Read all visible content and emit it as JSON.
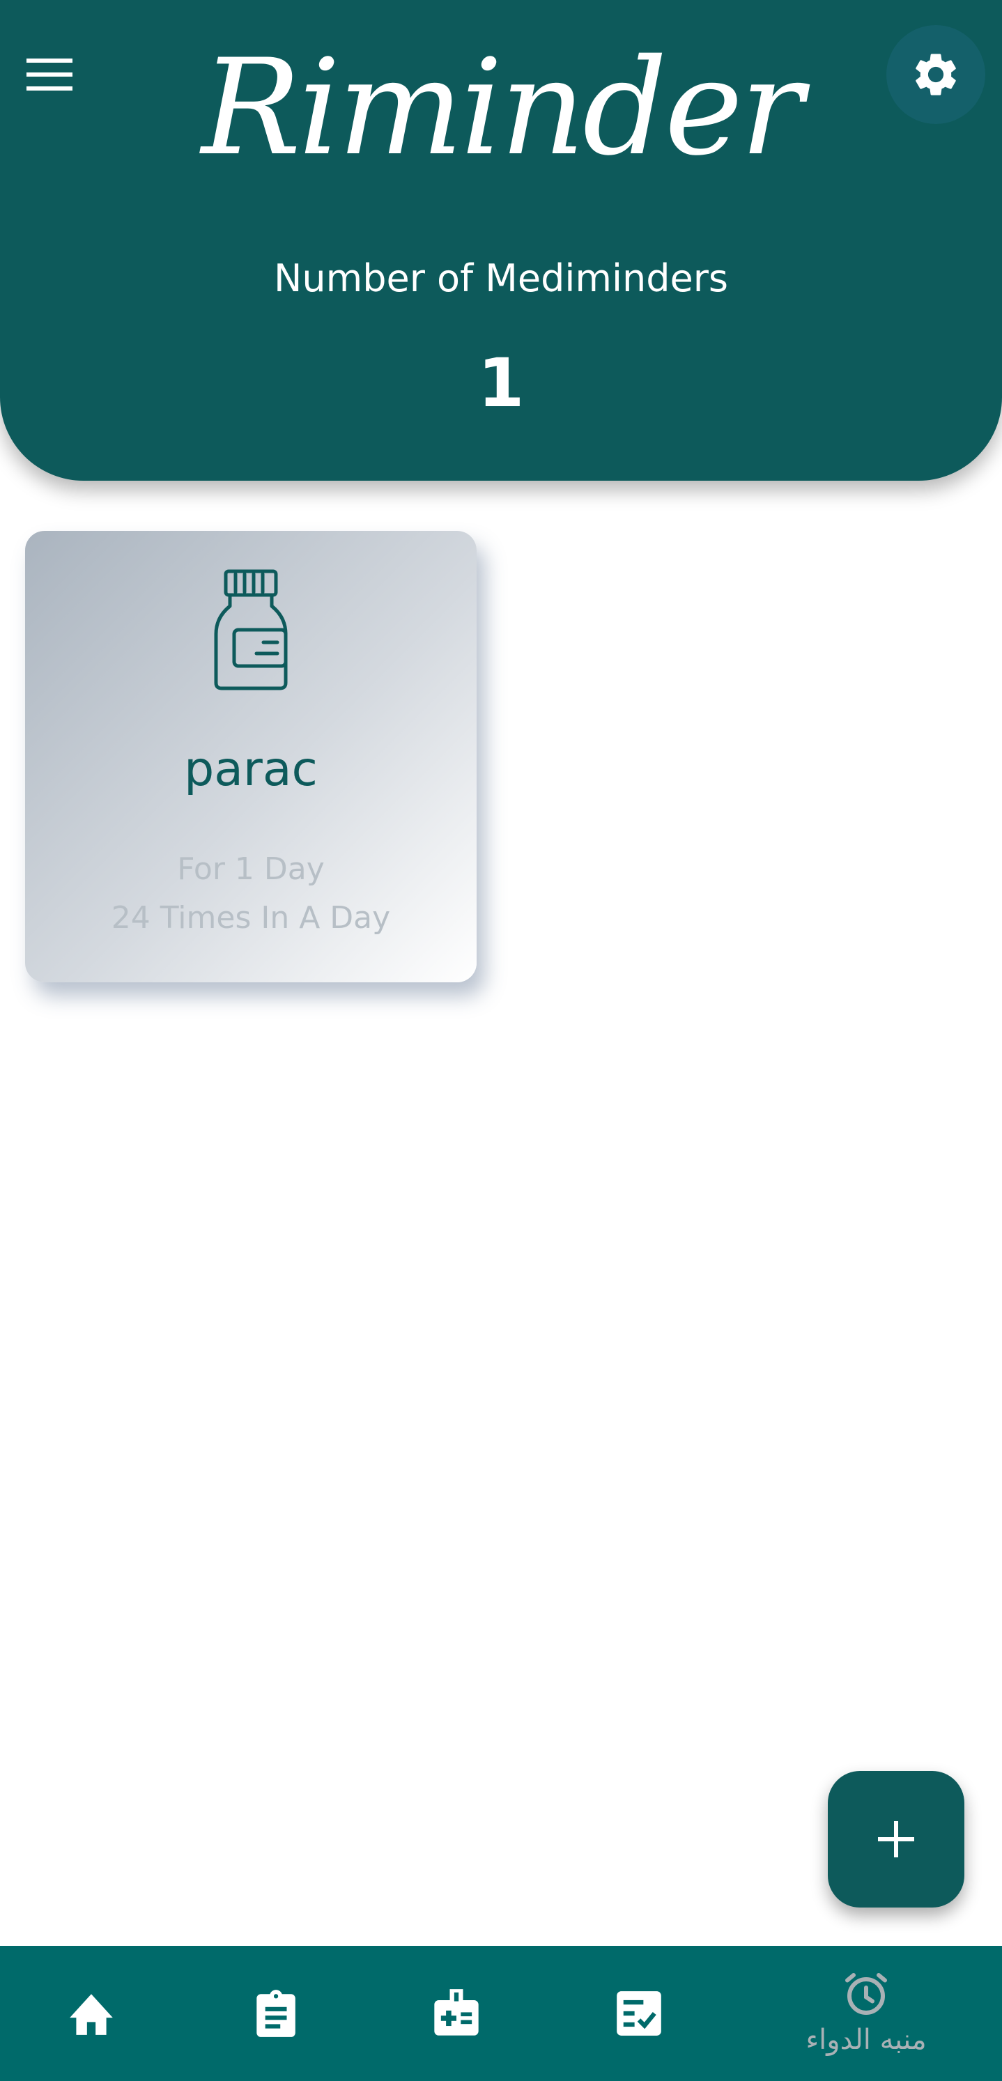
{
  "header": {
    "title": "Riminder",
    "count_label": "Number of Mediminders",
    "count_value": "1",
    "menu_icon": "hamburger-menu-icon",
    "settings_icon": "gear-icon"
  },
  "reminders": [
    {
      "name": "parac",
      "duration": "For 1 Day",
      "frequency": "24 Times In A Day",
      "icon": "medicine-bottle-icon"
    }
  ],
  "fab": {
    "icon": "plus-icon"
  },
  "bottom_nav": {
    "items": [
      {
        "icon": "home-icon"
      },
      {
        "icon": "clipboard-icon"
      },
      {
        "icon": "medical-kit-icon"
      },
      {
        "icon": "checklist-icon"
      },
      {
        "icon": "alarm-clock-icon",
        "label": "منبه الدواء"
      }
    ]
  },
  "colors": {
    "primary": "#0d5a5b",
    "nav_background": "#006a6a",
    "card_text": "#0d5a5b",
    "card_subtext": "#b7bfc6",
    "nav_inactive": "#a9b1b5"
  }
}
